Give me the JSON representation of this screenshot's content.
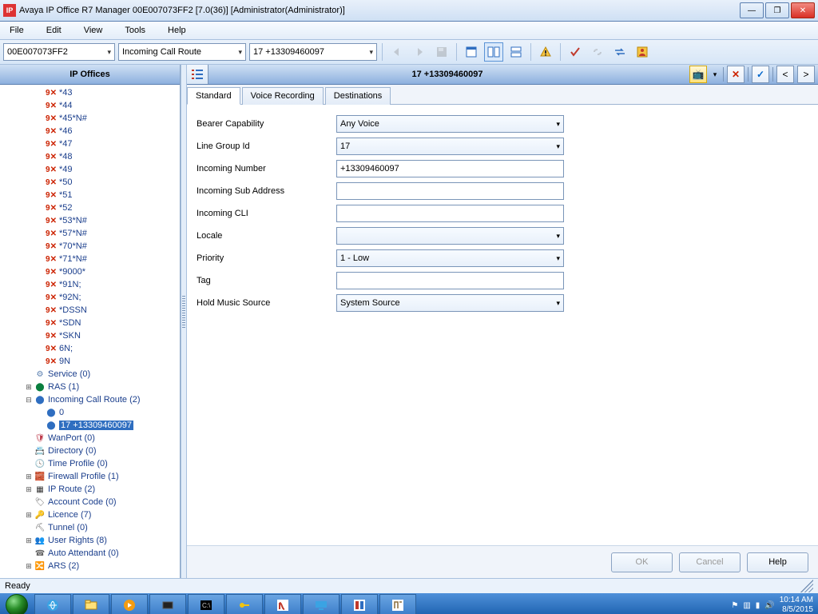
{
  "window": {
    "title": "Avaya IP Office R7 Manager 00E007073FF2 [7.0(36)] [Administrator(Administrator)]"
  },
  "menu": {
    "file": "File",
    "edit": "Edit",
    "view": "View",
    "tools": "Tools",
    "help": "Help"
  },
  "combos": {
    "system": "00E007073FF2",
    "type": "Incoming Call Route",
    "item": "17 +13309460097"
  },
  "left": {
    "title": "IP Offices",
    "shortcodes": [
      "*43",
      "*44",
      "*45*N#",
      "*46",
      "*47",
      "*48",
      "*49",
      "*50",
      "*51",
      "*52",
      "*53*N#",
      "*57*N#",
      "*70*N#",
      "*71*N#",
      "*9000*",
      "*91N;",
      "*92N;",
      "*DSSN",
      "*SDN",
      "*SKN",
      "6N;",
      "9N"
    ],
    "nodes": {
      "service": "Service (0)",
      "ras": "RAS (1)",
      "icr": "Incoming Call Route (2)",
      "icr_children": [
        "0",
        "17 +13309460097"
      ],
      "wanport": "WanPort (0)",
      "directory": "Directory (0)",
      "timeprofile": "Time Profile (0)",
      "firewall": "Firewall Profile (1)",
      "iproute": "IP Route (2)",
      "account": "Account Code (0)",
      "licence": "Licence (7)",
      "tunnel": "Tunnel (0)",
      "userrights": "User Rights (8)",
      "autoatt": "Auto Attendant (0)",
      "ars": "ARS (2)"
    }
  },
  "right": {
    "title": "17 +13309460097",
    "tabs": {
      "standard": "Standard",
      "voice": "Voice Recording",
      "dest": "Destinations"
    },
    "fields": {
      "bearer_l": "Bearer Capability",
      "bearer_v": "Any Voice",
      "lgid_l": "Line Group Id",
      "lgid_v": "17",
      "incnum_l": "Incoming Number",
      "incnum_v": "+13309460097",
      "incsub_l": "Incoming Sub Address",
      "incsub_v": "",
      "inccli_l": "Incoming CLI",
      "inccli_v": "",
      "locale_l": "Locale",
      "locale_v": "",
      "prio_l": "Priority",
      "prio_v": "1 - Low",
      "tag_l": "Tag",
      "tag_v": "",
      "hold_l": "Hold Music Source",
      "hold_v": "System Source"
    },
    "buttons": {
      "ok": "OK",
      "cancel": "Cancel",
      "help": "Help"
    }
  },
  "status": {
    "text": "Ready"
  },
  "tray": {
    "time": "10:14 AM",
    "date": "8/5/2015"
  }
}
